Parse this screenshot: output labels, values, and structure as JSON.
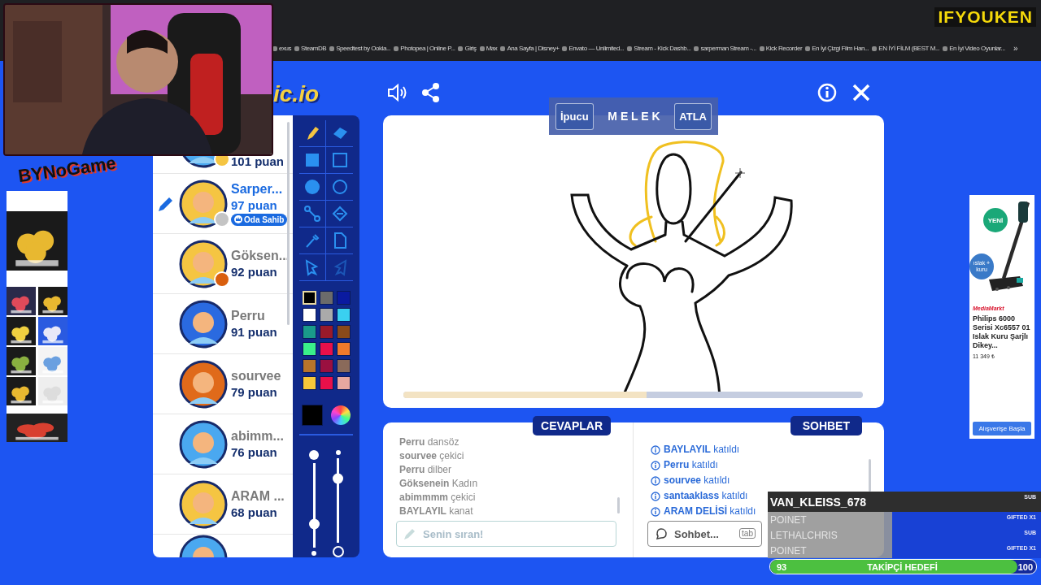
{
  "browser": {
    "bookmarks": [
      "exus",
      "SteamDB",
      "Speedtest by Ookla...",
      "Photopea | Online P...",
      "Giriş",
      "Max",
      "Ana Sayfa | Disney+",
      "Envato — Unlimited...",
      "Stream - Kick Dashb...",
      "sarperman Stream -...",
      "Kick Recorder",
      "En İyi Çizgi Film Han...",
      "EN İYİ FİLM (BEST M...",
      "En İyi Video Oyunlar..."
    ],
    "more": "»"
  },
  "stream_overlay": {
    "logo": "IFYOUKEN",
    "brand": "BYNoGame"
  },
  "game": {
    "logo": "ic.io",
    "hint": {
      "button": "İpucu",
      "word": "M E L E K",
      "skip": "ATLA"
    },
    "players": [
      {
        "score": "101 puan",
        "drawing": false,
        "color": "#f5c542"
      },
      {
        "name": "Sarper...",
        "score": "97 puan",
        "drawing": true,
        "badge": "Oda Sahib",
        "color": "#c4c4c4"
      },
      {
        "name": "Göksen...",
        "score": "92 puan",
        "drawing": false,
        "color": "#d95f0e"
      },
      {
        "name": "Perru",
        "score": "91 puan",
        "drawing": false
      },
      {
        "name": "sourvee",
        "score": "79 puan",
        "drawing": false
      },
      {
        "name": "abimm...",
        "score": "76 puan",
        "drawing": false
      },
      {
        "name": "ARAM ...",
        "score": "68 puan",
        "drawing": false
      }
    ],
    "tools": [
      {
        "kind": "pencil",
        "selected": true,
        "disabled": false
      },
      {
        "kind": "eraser",
        "selected": false,
        "disabled": false
      },
      {
        "kind": "filled-rect",
        "selected": false,
        "disabled": false
      },
      {
        "kind": "rect",
        "selected": false,
        "disabled": false
      },
      {
        "kind": "filled-circle",
        "selected": false,
        "disabled": false
      },
      {
        "kind": "circle",
        "selected": false,
        "disabled": false
      },
      {
        "kind": "line",
        "selected": false,
        "disabled": false
      },
      {
        "kind": "bucket",
        "selected": false,
        "disabled": false
      },
      {
        "kind": "dropper",
        "selected": false,
        "disabled": false
      },
      {
        "kind": "page",
        "selected": false,
        "disabled": false
      },
      {
        "kind": "undo",
        "selected": false,
        "disabled": false
      },
      {
        "kind": "redo",
        "selected": false,
        "disabled": true
      }
    ],
    "palette": [
      {
        "color": "#000000",
        "selected": true
      },
      {
        "color": "#6b6b6b",
        "selected": false
      },
      {
        "color": "#0a1aa0",
        "selected": false
      },
      {
        "color": "#ffffff",
        "selected": false
      },
      {
        "color": "#aaaaaa",
        "selected": false
      },
      {
        "color": "#3ad0f0",
        "selected": false
      },
      {
        "color": "#1a9a8a",
        "selected": false
      },
      {
        "color": "#9a1a2a",
        "selected": false
      },
      {
        "color": "#8a4a1a",
        "selected": false
      },
      {
        "color": "#3af08a",
        "selected": false
      },
      {
        "color": "#e8104a",
        "selected": false
      },
      {
        "color": "#f07a2a",
        "selected": false
      },
      {
        "color": "#b8742a",
        "selected": false
      },
      {
        "color": "#9a1040",
        "selected": false
      },
      {
        "color": "#8a6a5a",
        "selected": false
      },
      {
        "color": "#f8c83a",
        "selected": false
      },
      {
        "color": "#e8104a",
        "selected": false
      },
      {
        "color": "#e8a8a0",
        "selected": false
      }
    ],
    "current_swatch": {
      "color": "#000000"
    },
    "sliders": [
      {
        "level": 0.25
      },
      {
        "level": 0.8
      }
    ],
    "timer": {
      "level": 0.53
    },
    "answers": {
      "tab": "CEVAPLAR",
      "items": [
        "**Perru** dansöz",
        "**sourvee** çekici",
        "**Perru** dilber",
        "**Göksenein** Kadın",
        "**abimmmm** çekici",
        "**BAYLAYIL** kanat"
      ],
      "placeholder": "Senin sıran!"
    },
    "chat": {
      "tab": "SOHBET",
      "items": [
        "**BAYLAYIL** katıldı",
        "**Perru** katıldı",
        "**sourvee** katıldı",
        "**santaaklass** katıldı",
        "**ARAM DELİSİ** katıldı"
      ],
      "placeholder": "Sohbet...",
      "shortcut": "tab"
    }
  },
  "ad": {
    "badges": [
      "YENİ",
      "ıslak + kuru"
    ],
    "brand": "MediaMarkt",
    "title": "Philips 6000 Serisi Xc6557 01 Islak Kuru Şarjlı Dikey...",
    "price": "11 349 ₺",
    "button": "Alışverişe Başla"
  },
  "subs": {
    "events": [
      {
        "name": "VAN_KLEISS_678",
        "event": "SUB",
        "latest": true
      },
      {
        "name": "POINET",
        "event": "GIFTED X1",
        "latest": false
      },
      {
        "name": "LETHALCHRIS",
        "event": "SUB",
        "latest": false
      },
      {
        "name": "POINET",
        "event": "GIFTED X1",
        "latest": false
      }
    ],
    "goal": {
      "current": "93",
      "label": "TAKİPÇİ HEDEFİ",
      "target": "100",
      "level": 0.93
    }
  }
}
